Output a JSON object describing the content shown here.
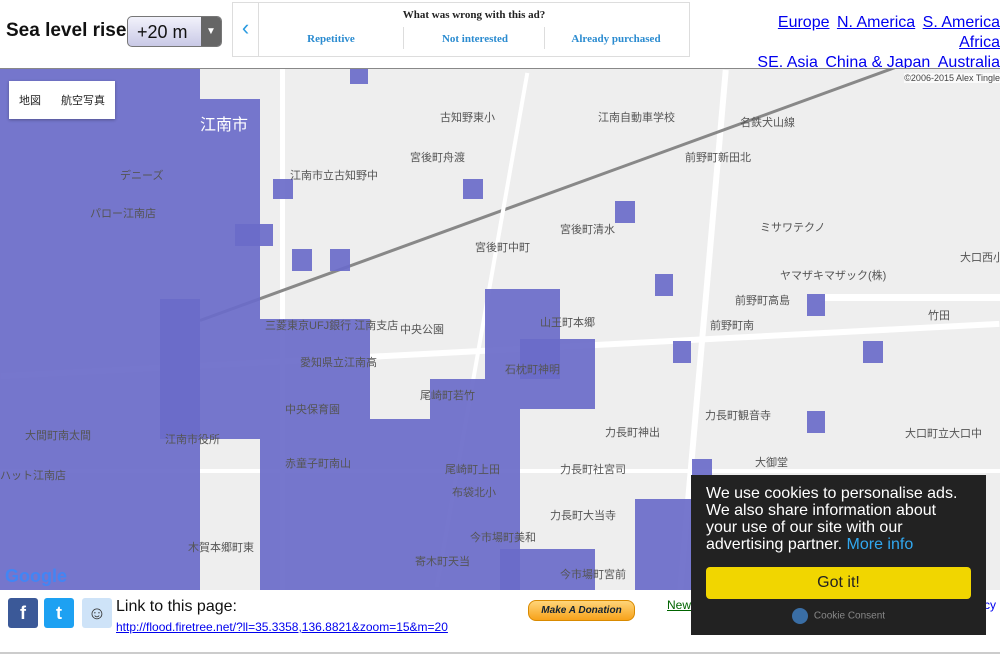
{
  "header": {
    "sea_level_label": "Sea level rise:",
    "sea_level_value": "+20 m"
  },
  "ad": {
    "question": "What was wrong with this ad?",
    "options": [
      "Repetitive",
      "Not interested",
      "Already purchased"
    ]
  },
  "regions": [
    "Europe",
    "N. America",
    "S. America",
    "Africa",
    "SE. Asia",
    "China & Japan",
    "Australia"
  ],
  "map": {
    "type_buttons": [
      "地図",
      "航空写真"
    ],
    "copyright": "©2006-2015 Alex Tingle",
    "logo": "Google",
    "labels": [
      "江南市",
      "名鉄犬山線",
      "古知野東小",
      "江南自動車学校",
      "前野町新田北",
      "宮後町舟渡",
      "江南市立古知野中",
      "宮後町清水",
      "ミサワテクノ",
      "大口西小",
      "宮後町中町",
      "ヤマザキマザック(株)",
      "中央公園",
      "山王町本郷",
      "前野町高島",
      "竹田",
      "三菱東京UFJ銀行 江南支店",
      "愛知県立江南高",
      "石枕町神明",
      "前野町南",
      "江南市役所",
      "中央保育園",
      "尾崎町若竹",
      "力長町観音寺",
      "大口町立大口中",
      "力長町神出",
      "大御堂",
      "赤童子町南山",
      "尾崎町上田",
      "力長町社宮司",
      "布袋北小",
      "力長町大当寺",
      "今市場町美和",
      "寄木町天当",
      "木賀本郷町東",
      "今市場町宮前",
      "デニーズ",
      "パロー江南店",
      "ハット江南店",
      "大間町南太間"
    ]
  },
  "colors": {
    "flood": "#6a6bc9",
    "map_bg": "#eeeeee"
  },
  "footer": {
    "link_label": "Link to this page:",
    "url": "http://flood.firetree.net/?ll=35.3358,136.8821&zoom=15&m=20",
    "donate": "Make A Donation",
    "new_link": "New",
    "cy_link": "cy"
  },
  "cookie": {
    "text": "We use cookies to personalise ads. We also share information about your use of our site with our advertising partner.",
    "more": "More info",
    "button": "Got it!",
    "brand": "Cookie Consent"
  }
}
